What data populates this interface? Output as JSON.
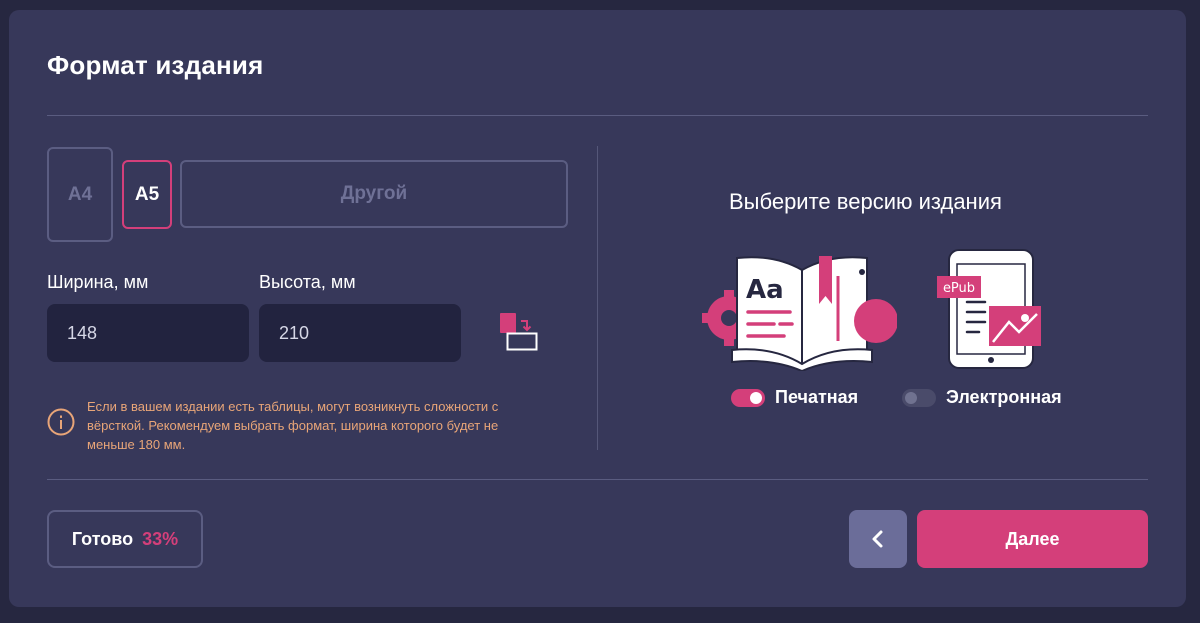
{
  "header": {
    "title": "Формат издания"
  },
  "format": {
    "options": [
      {
        "label": "A4",
        "selected": false
      },
      {
        "label": "A5",
        "selected": true
      },
      {
        "label": "Другой",
        "selected": false
      }
    ]
  },
  "dimensions": {
    "width_label": "Ширина, мм",
    "width_value": "148",
    "height_label": "Высота, мм",
    "height_value": "210"
  },
  "notice": {
    "icon": "info-icon",
    "text": "Если в вашем издании есть таблицы, могут возникнуть сложности с вёрсткой. Рекомендуем выбрать формат, ширина которого будет не меньше 180 мм."
  },
  "version": {
    "title": "Выберите версию издания",
    "print_label": "Печатная",
    "print_enabled": true,
    "ebook_label": "Электронная",
    "ebook_enabled": false,
    "epub_badge": "ePub",
    "book_letters": "Aa"
  },
  "footer": {
    "progress_label": "Готово",
    "progress_value": "33%",
    "back_icon": "chevron-left-icon",
    "next_label": "Далее"
  },
  "colors": {
    "accent": "#d43f7a",
    "card": "#37385a",
    "background": "#262740",
    "warning": "#e8a578",
    "input": "#22233f"
  }
}
